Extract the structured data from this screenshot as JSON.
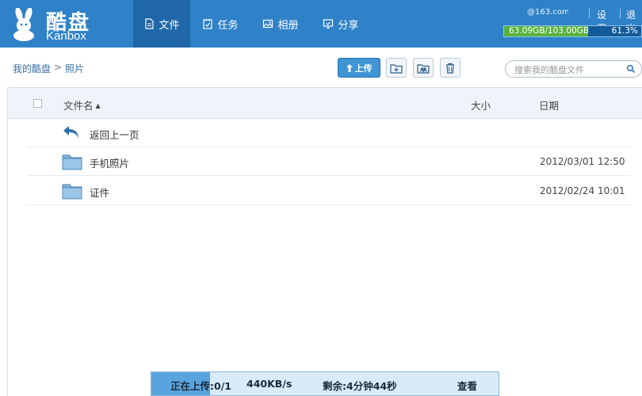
{
  "brand": {
    "name_cn": "酷盘",
    "name_en": "Kanbox"
  },
  "nav": {
    "items": [
      {
        "label": "文件",
        "icon": "file-icon",
        "active": true
      },
      {
        "label": "任务",
        "icon": "task-icon",
        "active": false
      },
      {
        "label": "相册",
        "icon": "album-icon",
        "active": false
      },
      {
        "label": "分享",
        "icon": "share-icon",
        "active": false
      }
    ]
  },
  "user": {
    "email": "@163.com",
    "settings_label": "设置",
    "logout_label": "退出",
    "quota_text": "63.09GB/103.00GB",
    "quota_percent_text": "61.3%",
    "quota_fraction": 0.613
  },
  "breadcrumb": {
    "root": "我的酷盘",
    "separator": ">",
    "current": "照片"
  },
  "toolbar": {
    "upload_label": "上传",
    "new_folder_icon": "new-folder-icon",
    "share_folder_icon": "shared-folder-icon",
    "delete_icon": "trash-icon"
  },
  "search": {
    "placeholder": "搜索我的酷盘文件"
  },
  "table": {
    "columns": {
      "name": "文件名",
      "size": "大小",
      "date": "日期"
    },
    "back_label": "返回上一页",
    "rows": [
      {
        "name": "手机照片",
        "date": "2012/03/01 12:50"
      },
      {
        "name": "证件",
        "date": "2012/02/24 10:01"
      }
    ]
  },
  "upload_status": {
    "uploading": "正在上传:0/1",
    "speed": "440KB/s",
    "remaining": "剩余:4分钟44秒",
    "view_label": "查看",
    "progress_fraction": 0.17
  },
  "colors": {
    "header": "#2f82c8",
    "active_nav": "#1f67a8",
    "quota_fill": "#58b23e",
    "upload_button": "#3f94d3"
  }
}
